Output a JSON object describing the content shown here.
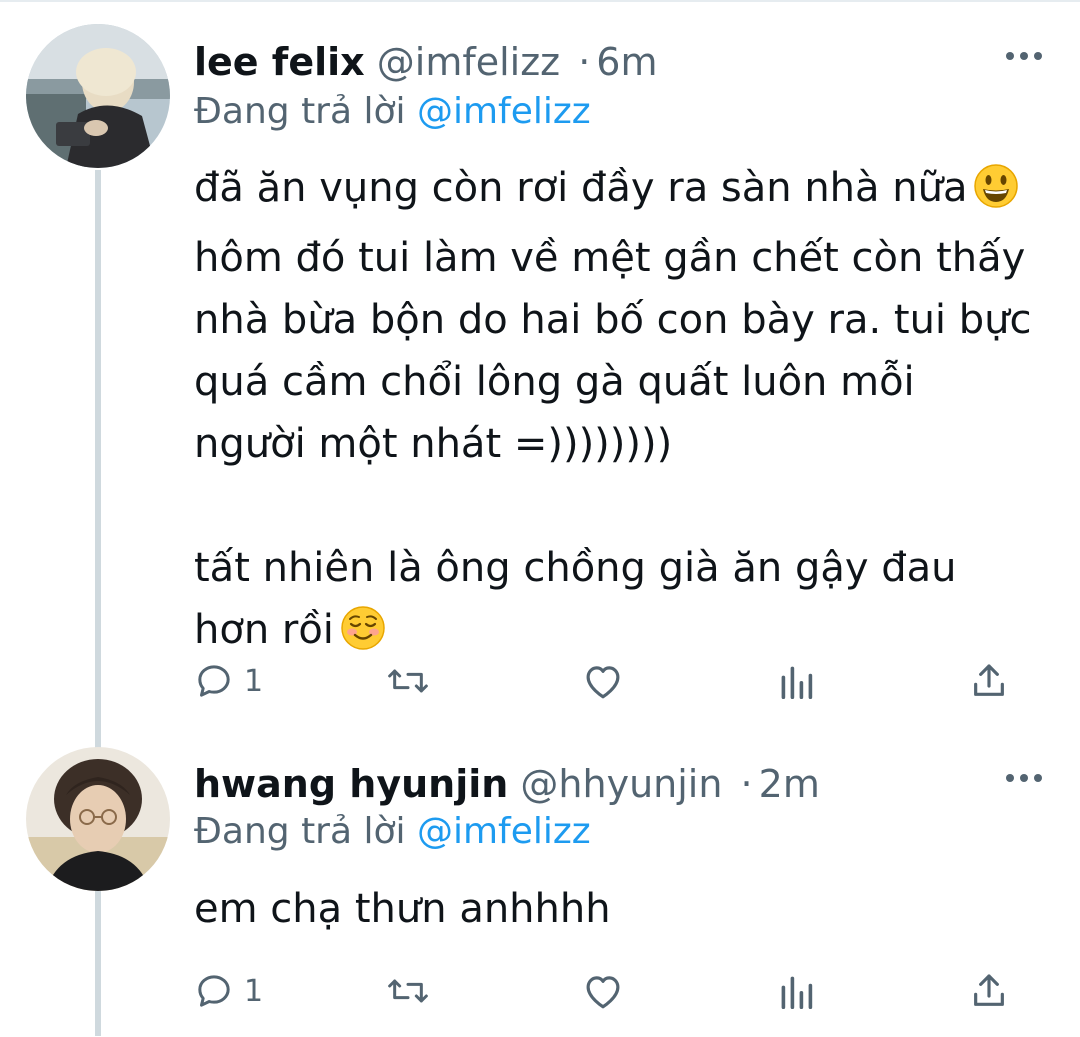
{
  "tweets": [
    {
      "display_name": "lee felix",
      "handle": "@imfelizz",
      "separator": "·",
      "time": "6m",
      "replying_label": "Đang trả lời",
      "replying_handle": "@imfelizz",
      "paragraph1": "đã ăn vụng còn rơi đầy ra sàn nhà nữa",
      "paragraph1_emoji": "grinning-face-emoji",
      "paragraph1_line2": "hôm đó tui làm về mệt gần chết còn thấy nhà bừa bộn do hai bố con bày ra. tui bực quá cầm chổi lông gà quất luôn mỗi người một nhát =))))))))",
      "paragraph2": "tất nhiên là ông chồng già ăn gậy đau hơn rồi",
      "paragraph2_emoji": "smiling-face-emoji",
      "reply_count": "1",
      "icons": [
        "reply-icon",
        "retweet-icon",
        "like-icon",
        "analytics-icon",
        "share-icon"
      ]
    },
    {
      "display_name": "hwang hyunjin",
      "handle": "@hhyunjin",
      "separator": "·",
      "time": "2m",
      "replying_label": "Đang trả lời",
      "replying_handle": "@imfelizz",
      "text": "em chạ thưn anhhhh",
      "reply_count": "1",
      "icons": [
        "reply-icon",
        "retweet-icon",
        "like-icon",
        "analytics-icon",
        "share-icon"
      ]
    }
  ],
  "colors": {
    "text": "#0f1419",
    "secondary": "#536471",
    "link": "#1d9bf0",
    "thread_line": "#cfd9de"
  }
}
